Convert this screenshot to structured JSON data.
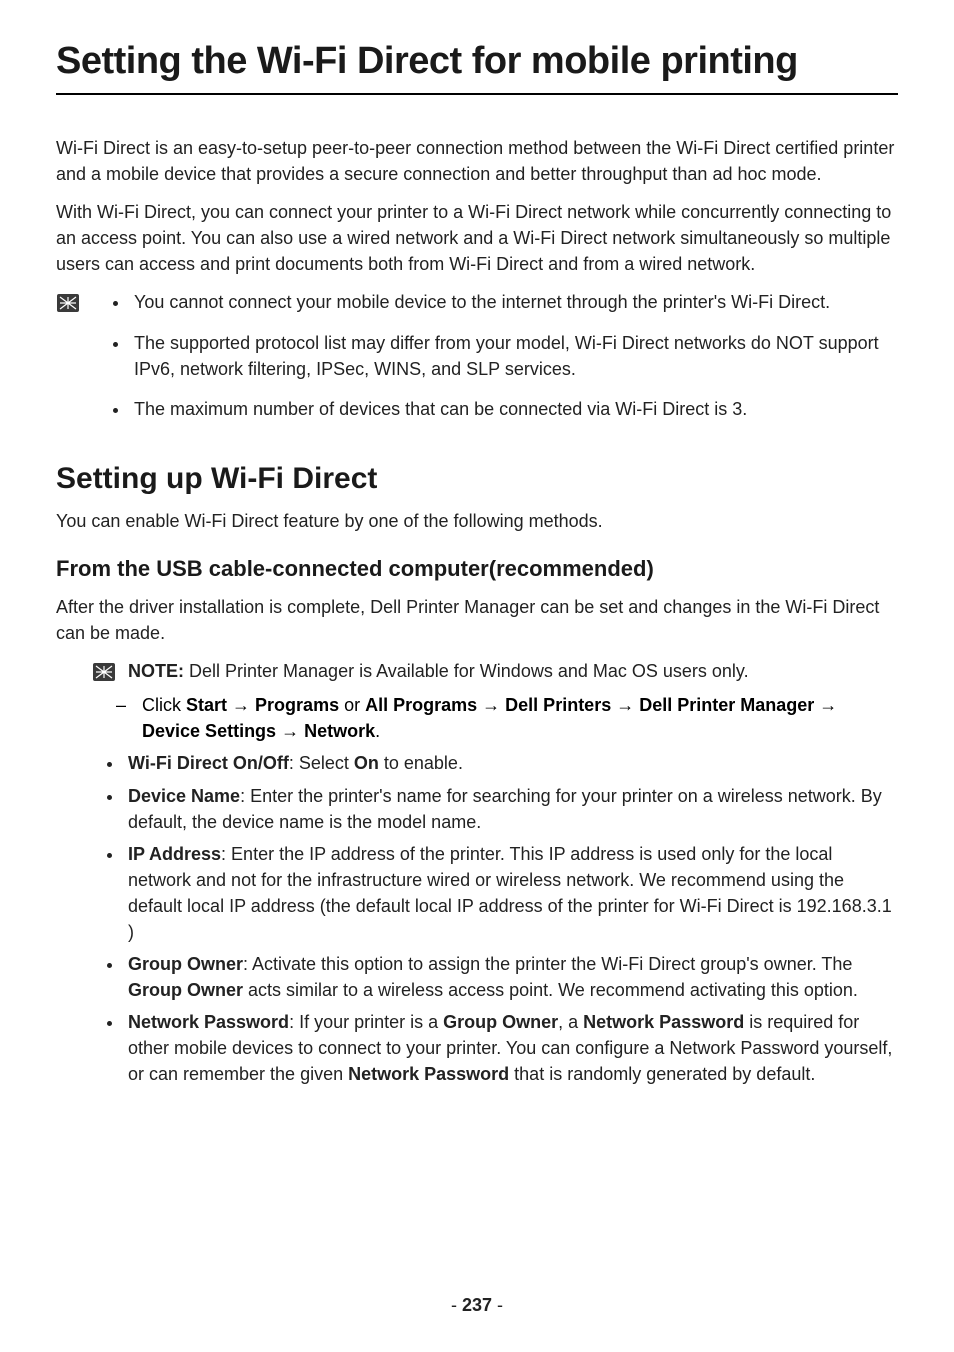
{
  "title": "Setting the Wi-Fi Direct for mobile printing",
  "intro1": "Wi-Fi Direct is an easy-to-setup peer-to-peer connection method between the Wi-Fi Direct certified printer and a mobile device that provides a secure connection and better throughput than ad hoc mode.",
  "intro2": "With Wi-Fi Direct, you can connect your printer to a Wi-Fi Direct network while concurrently connecting to an access point. You can also use a wired network and a Wi-Fi Direct network simultaneously so multiple users can access and print documents both from Wi-Fi Direct and from a wired network.",
  "notes1": [
    "You cannot connect your mobile device to the internet through the printer's Wi-Fi Direct.",
    "The supported protocol list may differ from your model, Wi-Fi Direct networks do NOT support IPv6, network filtering, IPSec, WINS, and SLP services.",
    "The maximum number of devices that can be connected via Wi-Fi Direct is 3."
  ],
  "h2": "Setting up Wi-Fi Direct",
  "h2_sub": "You can enable Wi-Fi Direct feature by one of the following methods.",
  "h3": "From the USB cable-connected computer(recommended)",
  "h3_para": "After the driver installation is complete, Dell Printer Manager can be set and changes in the Wi-Fi Direct can be made.",
  "note2_label": "NOTE:",
  "note2_text": " Dell Printer Manager is Available for Windows and Mac OS users only.",
  "path": {
    "prefix": "Click ",
    "start": "Start",
    "arrow": " → ",
    "programs": " Programs",
    "or": " or ",
    "allprograms": "All Programs",
    "dellprinters": " Dell Printers",
    "dellpm": " Dell Printer Manager",
    "devset": " Device Settings",
    "network": " Network",
    "period": "."
  },
  "bullets": {
    "b1_bold": "Wi-Fi Direct On/Off",
    "b1_mid": ": Select ",
    "b1_on": "On",
    "b1_end": " to enable.",
    "b2_bold": "Device Name",
    "b2_text": ": Enter the printer's name for searching for your printer on a wireless network. By default, the device name is the model name.",
    "b3_bold": "IP Address",
    "b3_text": ": Enter the IP address of the printer. This IP address is used only for the local network and not for the infrastructure wired or wireless network. We recommend using the default local IP address (the default local IP address of the printer for Wi-Fi Direct is 192.168.3.1 )",
    "b4_bold": "Group Owner",
    "b4_text_a": ": Activate this option to assign the printer the Wi-Fi Direct group's owner. The ",
    "b4_bold2": "Group Owner",
    "b4_text_b": " acts similar to a wireless access point. We recommend activating this option.",
    "b5_bold": "Network Password",
    "b5_a": ": If your printer is a ",
    "b5_go": "Group Owner",
    "b5_b": ", a ",
    "b5_np": "Network Password",
    "b5_c": " is required for other mobile devices to connect to your printer. You can configure a Network Password yourself, or can remember the given ",
    "b5_np2": "Network Password",
    "b5_d": " that is randomly generated by default."
  },
  "page_dash_a": "- ",
  "page_num": "237",
  "page_dash_b": " -"
}
